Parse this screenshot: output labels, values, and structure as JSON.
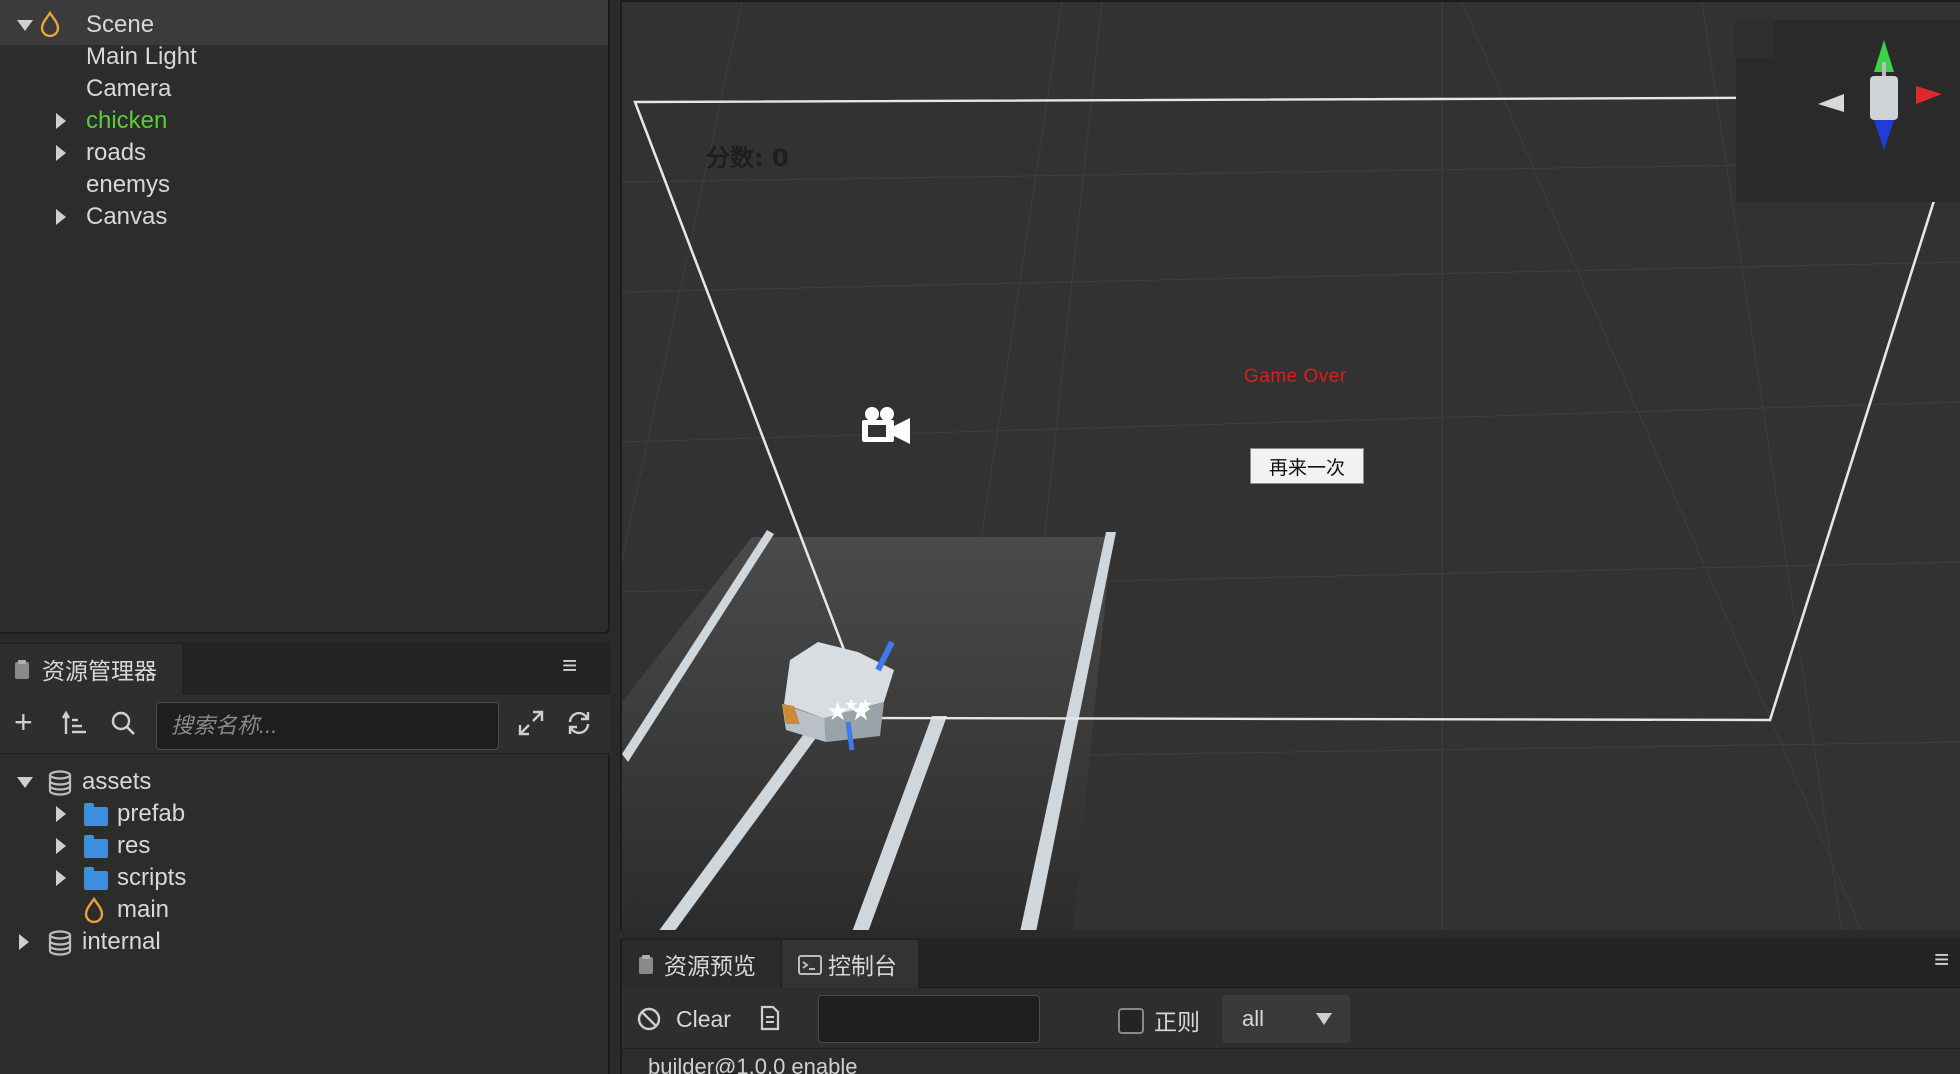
{
  "hierarchy": {
    "items": [
      {
        "label": "Scene",
        "expanded": true,
        "color": "#d8d8d8"
      },
      {
        "label": "Main Light",
        "color": "#d8d8d8"
      },
      {
        "label": "Camera",
        "color": "#d8d8d8"
      },
      {
        "label": "chicken",
        "collapsed": true,
        "color": "#5ccc3c"
      },
      {
        "label": "roads",
        "collapsed": true,
        "color": "#d8d8d8"
      },
      {
        "label": "enemys",
        "color": "#d8d8d8"
      },
      {
        "label": "Canvas",
        "collapsed": true,
        "color": "#d8d8d8"
      }
    ]
  },
  "assets": {
    "tab_label": "资源管理器",
    "search_placeholder": "搜索名称...",
    "tree": [
      {
        "label": "assets",
        "icon": "database-icon",
        "expanded": true
      },
      {
        "label": "prefab",
        "icon": "folder-icon",
        "collapsed": true
      },
      {
        "label": "res",
        "icon": "folder-icon",
        "collapsed": true
      },
      {
        "label": "scripts",
        "icon": "folder-icon",
        "collapsed": true
      },
      {
        "label": "main",
        "icon": "scene-icon"
      },
      {
        "label": "internal",
        "icon": "database-icon",
        "collapsed": true
      }
    ]
  },
  "scene": {
    "score_text": "分数: 0",
    "gameover_text": "Game Over",
    "retry_label": "再来一次"
  },
  "console": {
    "tabs": [
      {
        "label": "资源预览",
        "active": false
      },
      {
        "label": "控制台",
        "active": true
      }
    ],
    "clear_label": "Clear",
    "filter_value": "",
    "regex_label": "正则",
    "level_value": "all",
    "log_line": "builder@1.0.0 enable"
  },
  "colors": {
    "accent_green": "#5ccc3c",
    "gameover_red": "#e11b1b",
    "folder_blue": "#3d8fe0",
    "scene_orange": "#e8a33a"
  }
}
